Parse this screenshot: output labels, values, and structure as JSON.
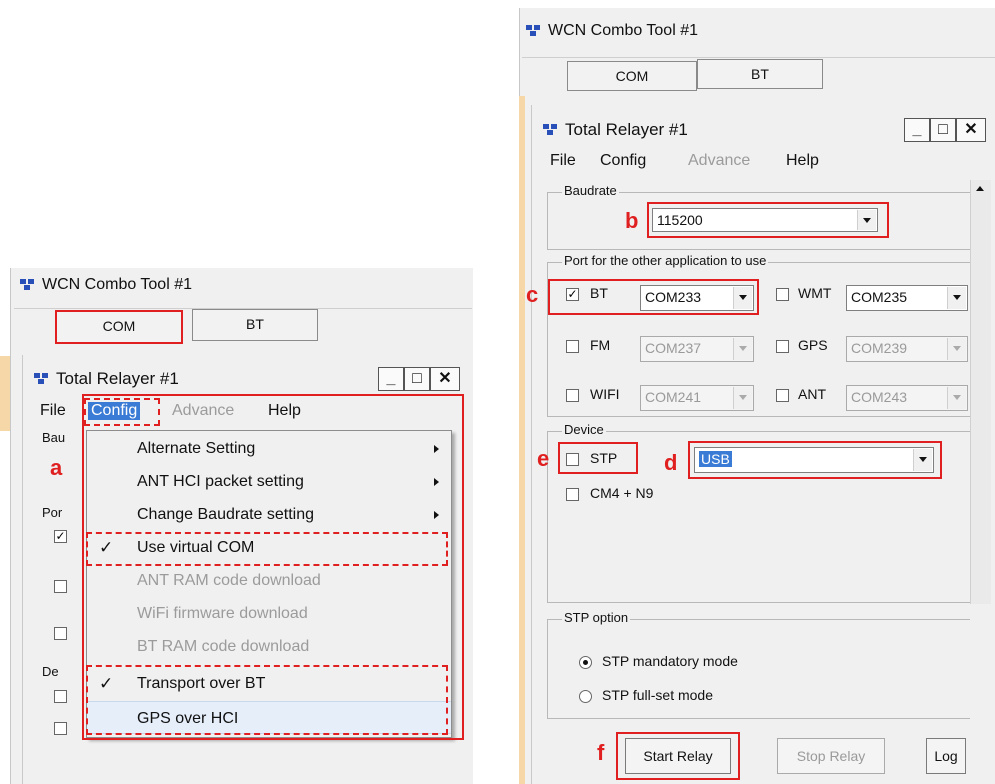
{
  "left": {
    "app_title": "WCN Combo Tool #1",
    "tabs": {
      "com": "COM",
      "bt": "BT"
    },
    "window_title": "Total Relayer #1",
    "win_buttons": {
      "minimize": "_",
      "maximize": "□",
      "close": "✕"
    },
    "menubar": {
      "file": "File",
      "config": "Config",
      "advance": "Advance",
      "help": "Help"
    },
    "config_menu": [
      {
        "label": "Alternate Setting",
        "checked": false,
        "submenu": true,
        "enabled": true
      },
      {
        "label": "ANT HCI packet setting",
        "checked": false,
        "submenu": true,
        "enabled": true
      },
      {
        "label": "Change Baudrate setting",
        "checked": false,
        "submenu": true,
        "enabled": true
      },
      {
        "label": "Use virtual COM",
        "checked": true,
        "submenu": false,
        "enabled": true
      },
      {
        "label": "ANT RAM code download",
        "checked": false,
        "submenu": false,
        "enabled": false
      },
      {
        "label": "WiFi firmware download",
        "checked": false,
        "submenu": false,
        "enabled": false
      },
      {
        "label": "BT RAM code download",
        "checked": false,
        "submenu": false,
        "enabled": false
      },
      {
        "label": "Transport over BT",
        "checked": true,
        "submenu": false,
        "enabled": true
      },
      {
        "label": "GPS over HCI",
        "checked": false,
        "submenu": false,
        "enabled": true
      }
    ],
    "partial_labels": {
      "baud": "Bau",
      "port": "Por",
      "device": "De"
    },
    "check_mark": "✓",
    "marker": "a"
  },
  "right": {
    "app_title": "WCN Combo Tool #1",
    "tabs": {
      "com": "COM",
      "bt": "BT"
    },
    "window_title": "Total Relayer #1",
    "win_buttons": {
      "minimize": "_",
      "maximize": "□",
      "close": "✕"
    },
    "menubar": {
      "file": "File",
      "config": "Config",
      "advance": "Advance",
      "help": "Help"
    },
    "baudrate_group": "Baudrate",
    "baudrate_value": "115200",
    "port_group": "Port for the other application to use",
    "ports": [
      {
        "label": "BT",
        "checked": true,
        "value": "COM233",
        "enabled": true
      },
      {
        "label": "WMT",
        "checked": false,
        "value": "COM235",
        "enabled": true
      },
      {
        "label": "FM",
        "checked": false,
        "value": "COM237",
        "enabled": false
      },
      {
        "label": "GPS",
        "checked": false,
        "value": "COM239",
        "enabled": false
      },
      {
        "label": "WIFI",
        "checked": false,
        "value": "COM241",
        "enabled": false
      },
      {
        "label": "ANT",
        "checked": false,
        "value": "COM243",
        "enabled": false
      }
    ],
    "device_group": "Device",
    "stp_label": "STP",
    "device_value": "USB",
    "cm4_label": "CM4 + N9",
    "stp_option_group": "STP option",
    "stp_options": [
      {
        "label": "STP mandatory mode",
        "selected": true
      },
      {
        "label": "STP full-set mode",
        "selected": false
      }
    ],
    "buttons": {
      "start": "Start Relay",
      "stop": "Stop Relay",
      "log": "Log"
    },
    "check_mark": "✓",
    "markers": {
      "b": "b",
      "c": "c",
      "d": "d",
      "e": "e",
      "f": "f"
    }
  }
}
